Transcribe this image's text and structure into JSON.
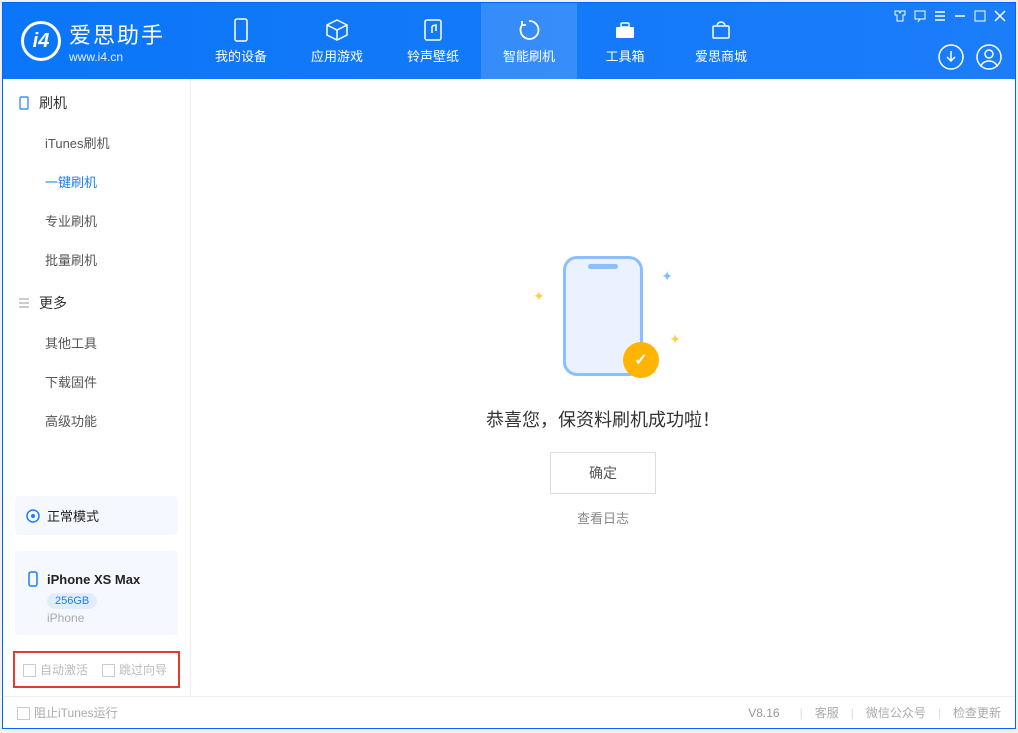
{
  "app": {
    "title": "爱思助手",
    "url": "www.i4.cn"
  },
  "nav": {
    "my_device": "我的设备",
    "apps_games": "应用游戏",
    "ringtone_wallpaper": "铃声壁纸",
    "smart_flash": "智能刷机",
    "toolbox": "工具箱",
    "store": "爱思商城"
  },
  "sidebar": {
    "group_flash": "刷机",
    "items_flash": {
      "itunes": "iTunes刷机",
      "oneclick": "一键刷机",
      "pro": "专业刷机",
      "batch": "批量刷机"
    },
    "group_more": "更多",
    "items_more": {
      "other_tools": "其他工具",
      "download_fw": "下载固件",
      "advanced": "高级功能"
    }
  },
  "device": {
    "mode": "正常模式",
    "name": "iPhone XS Max",
    "storage": "256GB",
    "type": "iPhone"
  },
  "options": {
    "auto_activate": "自动激活",
    "skip_guide": "跳过向导"
  },
  "main": {
    "success_msg": "恭喜您，保资料刷机成功啦！",
    "ok": "确定",
    "view_log": "查看日志"
  },
  "status": {
    "block_itunes": "阻止iTunes运行",
    "version": "V8.16",
    "support": "客服",
    "wechat": "微信公众号",
    "update": "检查更新"
  }
}
